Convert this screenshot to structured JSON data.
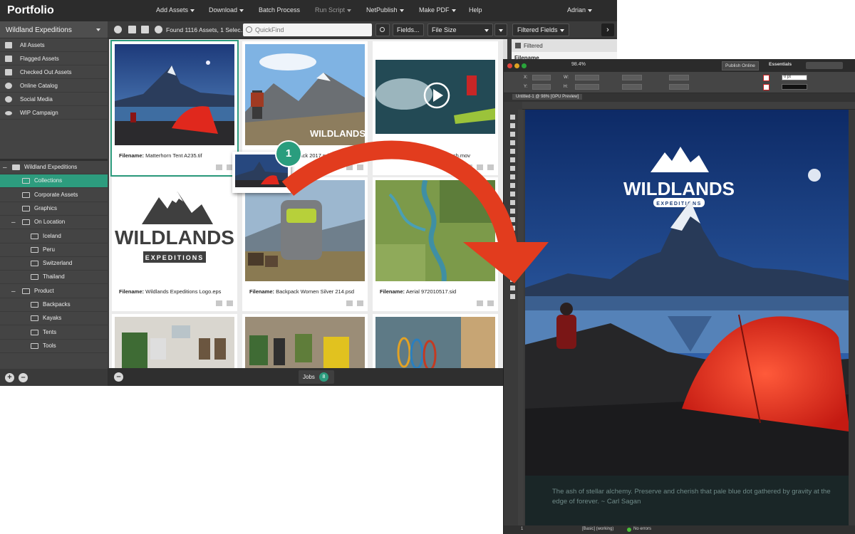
{
  "portfolio": {
    "brand": "Portfolio",
    "menus": [
      "Add Assets",
      "Download",
      "Batch Process",
      "Run Script",
      "NetPublish",
      "Make PDF",
      "Help"
    ],
    "user": "Adrian",
    "catalog": "Wildland Expeditions",
    "sidebar": [
      {
        "label": "All Assets",
        "icon": "stack-icon"
      },
      {
        "label": "Flagged Assets",
        "icon": "flag-icon"
      },
      {
        "label": "Checked Out Assets",
        "icon": "checkout-icon"
      },
      {
        "label": "Online Catalog",
        "icon": "person-icon"
      },
      {
        "label": "Social Media",
        "icon": "person-icon"
      },
      {
        "label": "WIP Campaign",
        "icon": "eye-icon"
      }
    ],
    "tree": [
      {
        "label": "Wildland Expeditions",
        "toggle": "–",
        "level": 0,
        "selected": false
      },
      {
        "label": "Collections",
        "toggle": "",
        "level": 1,
        "selected": true
      },
      {
        "label": "Corporate Assets",
        "toggle": "",
        "level": 1,
        "selected": false
      },
      {
        "label": "Graphics",
        "toggle": "",
        "level": 1,
        "selected": false
      },
      {
        "label": "On Location",
        "toggle": "–",
        "level": 1,
        "selected": false
      },
      {
        "label": "Iceland",
        "toggle": "",
        "level": 2,
        "selected": false
      },
      {
        "label": "Peru",
        "toggle": "",
        "level": 2,
        "selected": false
      },
      {
        "label": "Switzerland",
        "toggle": "",
        "level": 2,
        "selected": false
      },
      {
        "label": "Thailand",
        "toggle": "",
        "level": 2,
        "selected": false
      },
      {
        "label": "Product",
        "toggle": "–",
        "level": 1,
        "selected": false
      },
      {
        "label": "Backpacks",
        "toggle": "",
        "level": 2,
        "selected": false
      },
      {
        "label": "Kayaks",
        "toggle": "",
        "level": 2,
        "selected": false
      },
      {
        "label": "Tents",
        "toggle": "",
        "level": 2,
        "selected": false
      },
      {
        "label": "Tools",
        "toggle": "",
        "level": 2,
        "selected": false
      }
    ],
    "toolbar": {
      "found": "Found 1116 Assets, 1 Selec...",
      "search_placeholder": "QuickFind",
      "fields": "Fields...",
      "sort": "File Size",
      "filtered_fields": "Filtered Fields"
    },
    "filter_panel": {
      "title": "Filtered",
      "field": "Filename"
    },
    "caption_prefix": "Filename:",
    "assets": [
      {
        "filename": "Matterhorn Tent A235.tif",
        "selected": true
      },
      {
        "filename": "...d Backpack 2017.pdf",
        "selected": false
      },
      {
        "filename": "...Video-Kayak Splash.mov",
        "selected": false
      },
      {
        "filename": "Wildlands Expeditions Logo.eps",
        "selected": false
      },
      {
        "filename": "Backpack Women Silver 214.psd",
        "selected": false
      },
      {
        "filename": "Aerial 972010517.sid",
        "selected": false
      }
    ],
    "logo": {
      "word": "WILDLANDS",
      "tagline": "EXPEDITIONS"
    },
    "jobs": {
      "label": "Jobs",
      "count": "8"
    },
    "step_badge": "1"
  },
  "indesign": {
    "zoom": "98.4%",
    "publish": "Publish Online",
    "workspace": "Essentials",
    "doc_tab": "Untitled-1 @ 98% [GPU Preview]",
    "quote": "The ash of stellar alchemy. Preserve and cherish that pale blue dot gathered by gravity at the edge of forever. ~ Carl Sagan",
    "status": {
      "page": "1",
      "style": "[Basic] (working)",
      "errors": "No errors"
    },
    "control_labels": {
      "x": "X:",
      "y": "Y:",
      "w": "W:",
      "h": "H:",
      "stroke": "0 pt"
    }
  },
  "colors": {
    "accent": "#2d9c7e",
    "arrow": "#e23c1e"
  }
}
